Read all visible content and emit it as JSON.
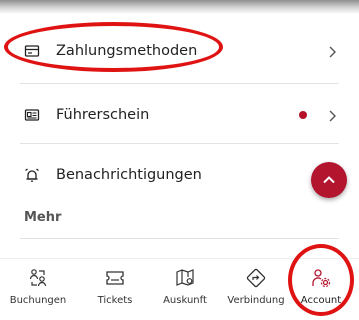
{
  "menu": {
    "items": [
      {
        "label": "Zahlungsmethoden",
        "icon": "credit-card-icon"
      },
      {
        "label": "Führerschein",
        "icon": "id-card-icon",
        "badge": "notification-dot"
      },
      {
        "label": "Benachrichtigungen",
        "icon": "alarm-bell-icon"
      }
    ],
    "section_heading": "Mehr"
  },
  "fab": {
    "icon": "chevron-up-icon"
  },
  "bottom_nav": {
    "items": [
      {
        "label": "Buchungen",
        "icon": "bookings-icon"
      },
      {
        "label": "Tickets",
        "icon": "ticket-icon"
      },
      {
        "label": "Auskunft",
        "icon": "map-icon"
      },
      {
        "label": "Verbindung",
        "icon": "direction-icon"
      },
      {
        "label": "Account",
        "icon": "account-icon"
      }
    ],
    "active": "Account"
  },
  "colors": {
    "accent": "#b3152f",
    "highlight": "#e01313",
    "dot": "#b5112a"
  }
}
